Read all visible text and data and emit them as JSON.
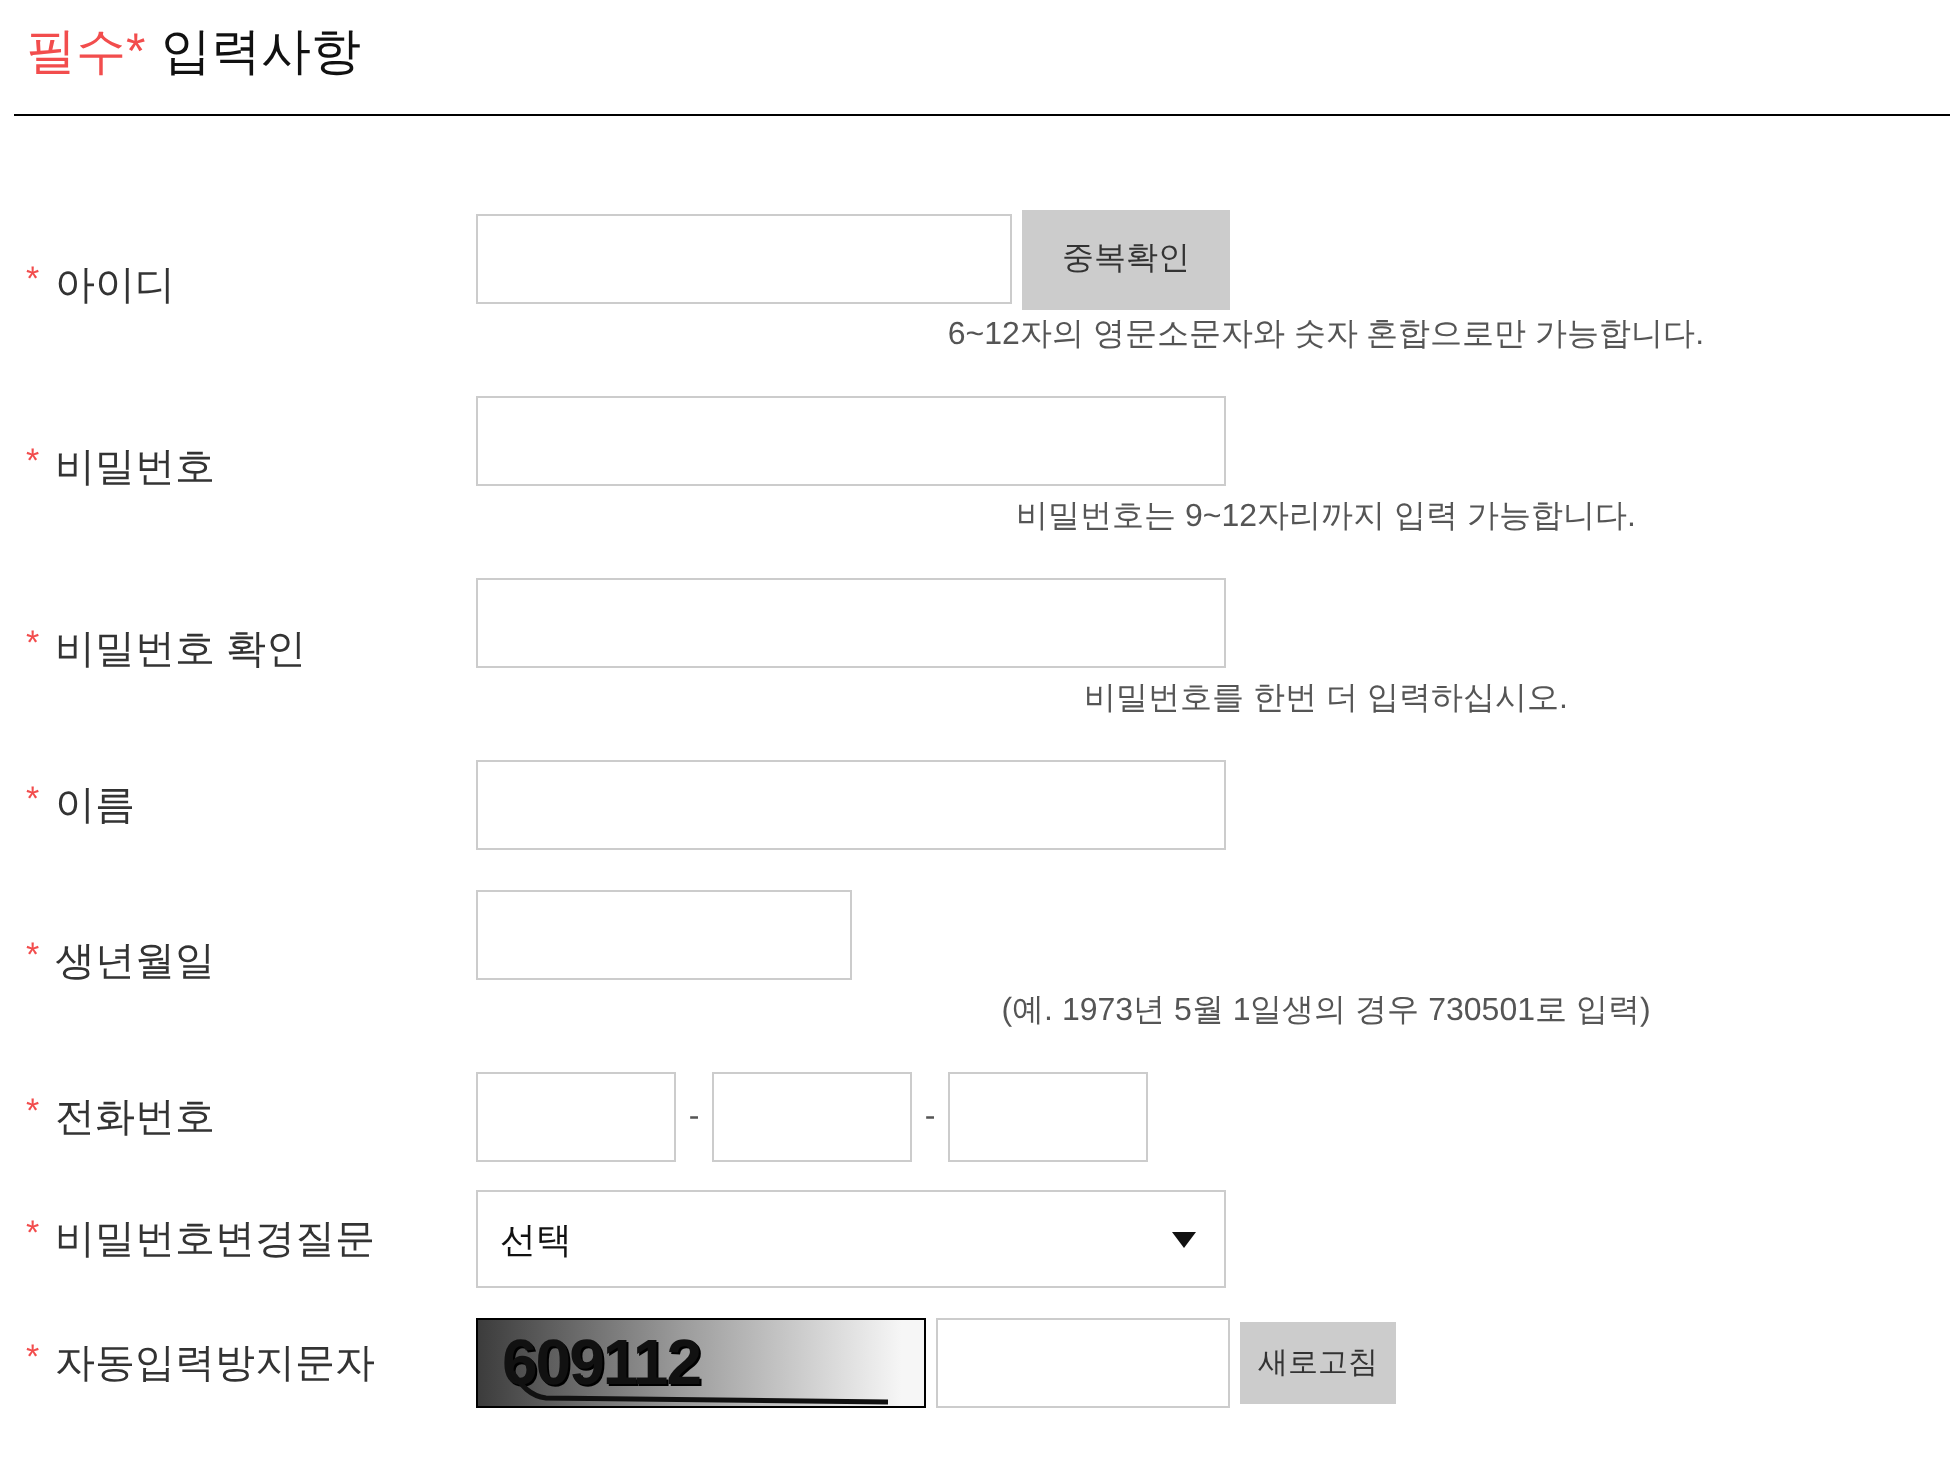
{
  "header": {
    "required_label": "필수*",
    "title": "입력사항"
  },
  "rows": [
    {
      "kind": "id",
      "mark": "*",
      "label": "아이디",
      "button": "중복확인",
      "hint": "6~12자의 영문소문자와 숫자 혼합으로만 가능합니다."
    },
    {
      "kind": "password",
      "mark": "*",
      "label": "비밀번호",
      "hint": "비밀번호는 9~12자리까지 입력 가능합니다."
    },
    {
      "kind": "password",
      "mark": "*",
      "label": "비밀번호 확인",
      "hint": "비밀번호를 한번 더 입력하십시오."
    },
    {
      "kind": "name",
      "mark": "*",
      "label": "이름"
    },
    {
      "kind": "date",
      "mark": "*",
      "label": "생년월일",
      "hint": "(예. 1973년 5월 1일생의 경우 730501로 입력)"
    },
    {
      "kind": "phone",
      "mark": "*",
      "label": "전화번호",
      "separators": [
        "-",
        "-"
      ]
    },
    {
      "kind": "select",
      "mark": "*",
      "label": "비밀번호변경질문",
      "value": "선택"
    },
    {
      "kind": "captcha",
      "mark": "*",
      "label": "자동입력방지문자",
      "captcha": "609112",
      "button": "새로고침"
    }
  ]
}
